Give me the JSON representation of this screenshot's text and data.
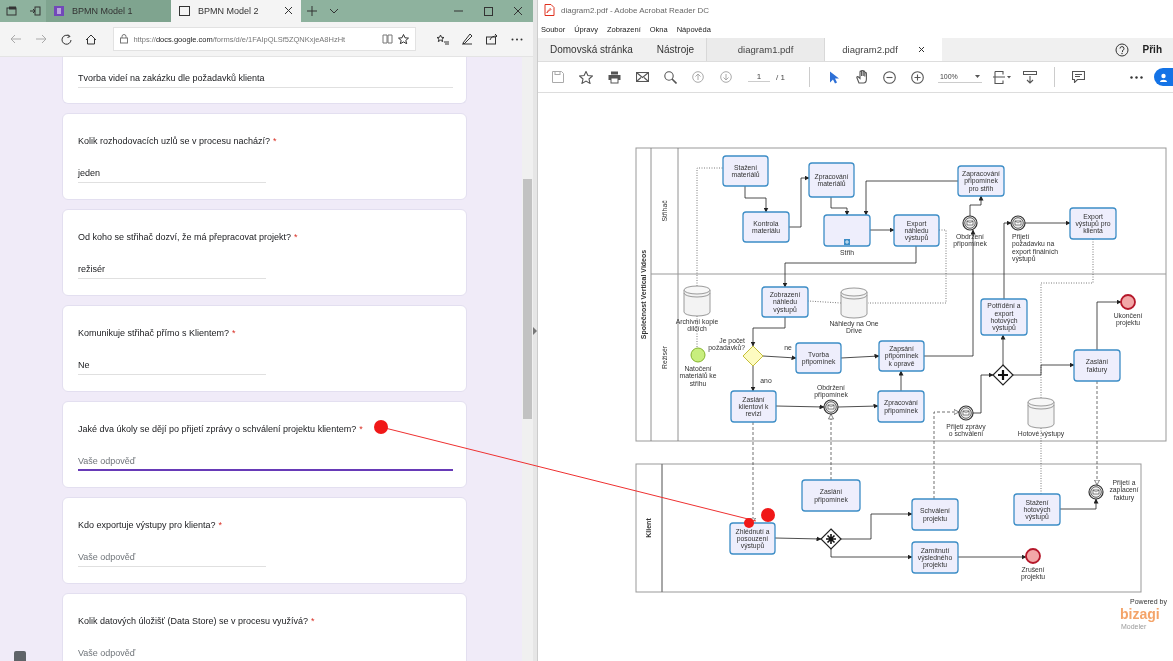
{
  "browser": {
    "tabs": [
      {
        "title": "BPMN Model 1",
        "selected": false
      },
      {
        "title": "BPMN Model 2",
        "selected": true
      }
    ],
    "url": "https://**docs.google.com**/forms/d/e/1FAIpQLSf5ZQNKxjeA8HzHt"
  },
  "form": {
    "items": [
      {
        "kind": "answer_only",
        "value": "Tvorba videí na zakázku dle požadavků klienta",
        "focused": false
      },
      {
        "kind": "question",
        "question": "Kolik rozhodovacích uzlů se v procesu nachází?",
        "required_mark": "*",
        "value": "jeden",
        "focused": false
      },
      {
        "kind": "question",
        "question": "Od koho se střihač dozví, že má přepracovat projekt?",
        "required_mark": "*",
        "value": "režisér",
        "focused": false
      },
      {
        "kind": "question",
        "question": "Komunikuje střihač přímo s Klientem?",
        "required_mark": "*",
        "value": "Ne",
        "focused": false
      },
      {
        "kind": "question",
        "question": "Jaké dva úkoly se dějí po přijetí zprávy o schválení projektu klientem?",
        "required_mark": "*",
        "placeholder": "Vaše odpověď",
        "focused": true
      },
      {
        "kind": "question",
        "question": "Kdo exportuje výstupy pro klienta?",
        "required_mark": "*",
        "placeholder": "Vaše odpověď",
        "focused": false
      },
      {
        "kind": "question",
        "question": "Kolik datových úložišť (Data Store) se v procesu využívá?",
        "required_mark": "*",
        "placeholder": "Vaše odpověď",
        "focused": false
      }
    ]
  },
  "reader": {
    "title": "diagram2.pdf - Adobe Acrobat Reader DC",
    "menu": [
      "Soubor",
      "Úpravy",
      "Zobrazení",
      "Okna",
      "Nápověda"
    ],
    "nav": [
      "Domovská stránka",
      "Nástroje"
    ],
    "tabs": [
      {
        "title": "diagram1.pdf",
        "selected": false
      },
      {
        "title": "diagram2.pdf",
        "selected": true
      }
    ],
    "sign_in": "Přih",
    "page_current": "1",
    "page_total": "/ 1",
    "zoom": "100%"
  },
  "diagram": {
    "pools": [
      {
        "label": "Společnost Vertical Videos",
        "lanes": [
          {
            "label": "Střihač"
          },
          {
            "label": "Režisér"
          }
        ]
      },
      {
        "label": "Klient"
      }
    ],
    "tasks": [
      {
        "kind": "task",
        "label": "Stažení materiálů"
      },
      {
        "kind": "task",
        "label": "Kontrola materiálu"
      },
      {
        "kind": "task",
        "label": "Zpracování materiálů"
      },
      {
        "kind": "subprocess",
        "label": "Střih"
      },
      {
        "kind": "task",
        "label": "Export náhledu výstupů"
      },
      {
        "kind": "task",
        "label": "Zapracování připomínek pro střih"
      },
      {
        "kind": "task",
        "label": "Export výstupů pro klienta"
      },
      {
        "kind": "task",
        "label": "Zobrazení náhledu výstupů"
      },
      {
        "kind": "task",
        "label": "Tvorba připomínek"
      },
      {
        "kind": "task",
        "label": "Zapsání připomínek k opravě"
      },
      {
        "kind": "task",
        "label": "Potřídění a export hotových výstupů"
      },
      {
        "kind": "task",
        "label": "Zaslání faktury"
      },
      {
        "kind": "task",
        "label": "Zaslání klientovi k revizi"
      },
      {
        "kind": "task",
        "label": "Zpracování připomínek"
      },
      {
        "kind": "task",
        "label": "Zhlédnutí a posouzení výstupů"
      },
      {
        "kind": "task",
        "label": "Zaslání připomínek"
      },
      {
        "kind": "task",
        "label": "Schválení projektu"
      },
      {
        "kind": "task",
        "label": "Zamítnutí výsledného projektu"
      },
      {
        "kind": "task",
        "label": "Stažení hotových výstupů"
      }
    ],
    "events": [
      {
        "kind": "start",
        "label": "Natočení materiálů ke střihu"
      },
      {
        "kind": "message",
        "label": "Obdržení připomínek"
      },
      {
        "kind": "message",
        "label": "Přijetí požadavku na export finálních výstupů"
      },
      {
        "kind": "end",
        "label": "Ukončení projektu"
      },
      {
        "kind": "message",
        "label": "Obdržení připomínek"
      },
      {
        "kind": "message",
        "label": "Přijetí zprávy o schválení"
      },
      {
        "kind": "end",
        "label": "Zrušení projektu"
      },
      {
        "kind": "message",
        "label": "Přijetí a zaplacení faktury"
      }
    ],
    "gateways": [
      {
        "kind": "exclusive",
        "label": "Je počet požadavků?"
      },
      {
        "kind": "parallel"
      },
      {
        "kind": "complex"
      }
    ],
    "data_stores": [
      {
        "label": "Archivní kopie dílčích"
      },
      {
        "label": "Náhledy na One Drive"
      },
      {
        "label": "Hotové výstupy"
      }
    ],
    "flow_labels": [
      "ne",
      "ano"
    ],
    "branding": {
      "tagline": "Powered by",
      "name": "bizagi",
      "product": "Modeler"
    }
  }
}
